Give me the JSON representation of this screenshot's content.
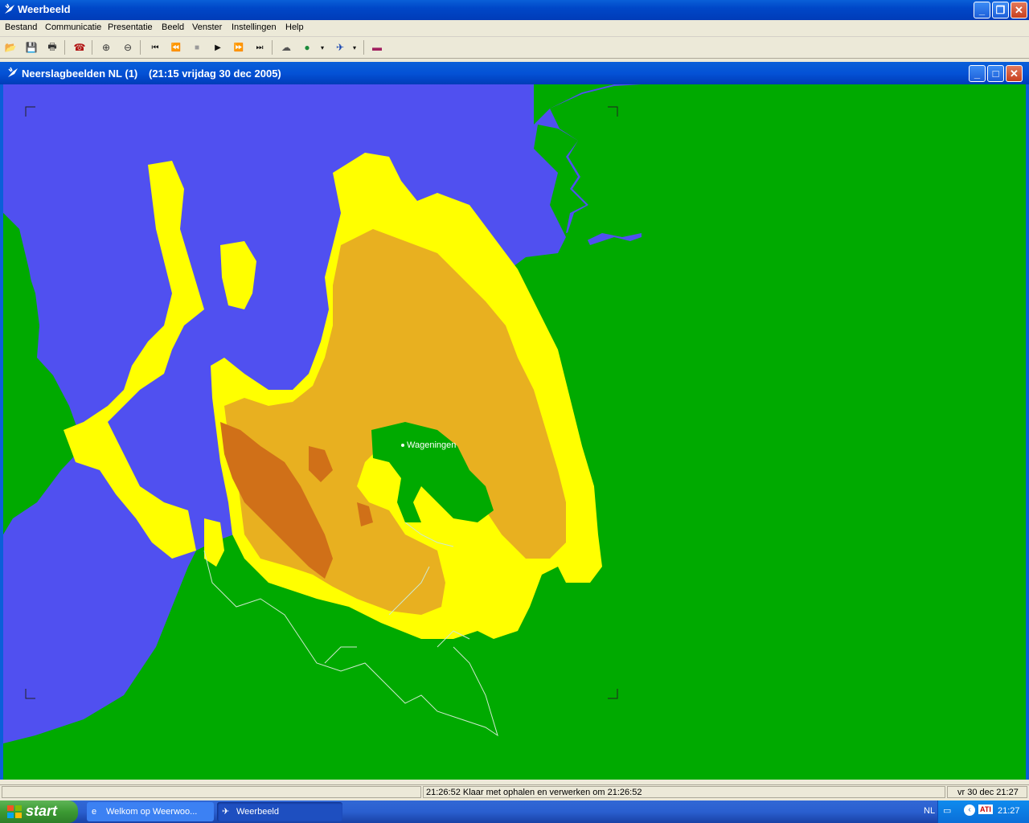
{
  "app": {
    "title": "Weerbeeld",
    "controls": {
      "minimize": "_",
      "restore": "❐",
      "close": "✕"
    }
  },
  "menu": [
    {
      "label": "Bestand"
    },
    {
      "label": "Communicatie"
    },
    {
      "label": "Presentatie"
    },
    {
      "label": "Beeld"
    },
    {
      "label": "Venster"
    },
    {
      "label": "Instellingen"
    },
    {
      "label": "Help"
    }
  ],
  "toolbar": {
    "icons": [
      "open-icon",
      "save-icon",
      "print-icon",
      "phone-icon",
      "zoom-in-icon",
      "zoom-out-icon",
      "first-frame-icon",
      "rewind-icon",
      "stop-icon",
      "play-icon",
      "fast-forward-icon",
      "last-frame-icon",
      "weather-icon",
      "globe-icon",
      "satellite-icon",
      "book-icon"
    ],
    "glyphs": {
      "open": "📂",
      "save": "💾",
      "print": "🖶",
      "phone": "☎",
      "zoom_in": "⊕",
      "zoom_out": "⊖",
      "first": "⏮",
      "rewind": "⏪",
      "stop": "■",
      "play": "▶",
      "ffwd": "⏩",
      "last": "⏭",
      "weather": "☁",
      "globe": "●",
      "satellite": "✈",
      "book": "▬"
    }
  },
  "child": {
    "title": "Neerslagbeelden NL (1)",
    "timestamp": "(21:15 vrijdag 30 dec 2005)"
  },
  "map": {
    "city_label": "Wageningen",
    "colors": {
      "land": "#00aa00",
      "sea": "#5050f0",
      "light_rain": "#ffff00",
      "moderate_rain": "#e8b020",
      "heavy_rain": "#d07018",
      "border": "#cfe8cf"
    }
  },
  "status": {
    "message": "21:26:52 Klaar met ophalen en verwerken om 21:26:52",
    "datetime": "vr 30 dec 21:27"
  },
  "taskbar": {
    "start": "start",
    "tasks": [
      {
        "label": "Welkom op Weerwoo..."
      },
      {
        "label": "Weerbeeld"
      }
    ],
    "tray": {
      "lang": "NL",
      "clock": "21:27"
    }
  }
}
